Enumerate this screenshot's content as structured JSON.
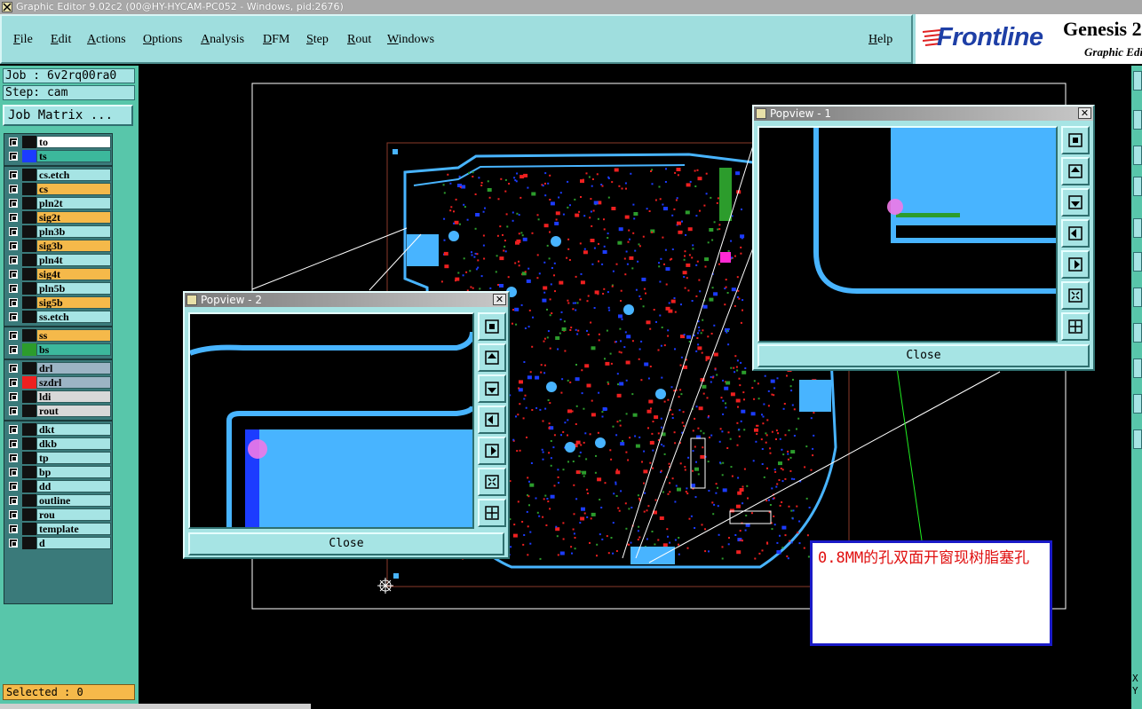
{
  "window": {
    "title": "Graphic Editor 9.02c2 (00@HY-HYCAM-PC052 - Windows, pid:2676)"
  },
  "menu": {
    "items": [
      "File",
      "Edit",
      "Actions",
      "Options",
      "Analysis",
      "DFM",
      "Step",
      "Rout",
      "Windows"
    ],
    "help": "Help"
  },
  "logo": {
    "brand": "Frontline",
    "product": "Genesis 2",
    "subtitle": "Graphic Edi"
  },
  "job": {
    "job_label": "Job : 6v2rq00ra0",
    "step_label": "Step: cam",
    "matrix_button": "Job Matrix ..."
  },
  "layers": [
    {
      "name": "to",
      "color": "#ffffff",
      "swatch": "#111111"
    },
    {
      "name": "ts",
      "color": "#3cb89c",
      "swatch": "#1c3cff"
    },
    {
      "name": "cs.etch",
      "color": "#a6e4e4",
      "swatch": "#111111"
    },
    {
      "name": "cs",
      "color": "#f5b94a",
      "swatch": "#111111"
    },
    {
      "name": "pln2t",
      "color": "#a6e4e4",
      "swatch": "#111111"
    },
    {
      "name": "sig2t",
      "color": "#f5b94a",
      "swatch": "#111111"
    },
    {
      "name": "pln3b",
      "color": "#a6e4e4",
      "swatch": "#111111"
    },
    {
      "name": "sig3b",
      "color": "#f5b94a",
      "swatch": "#111111"
    },
    {
      "name": "pln4t",
      "color": "#a6e4e4",
      "swatch": "#111111"
    },
    {
      "name": "sig4t",
      "color": "#f5b94a",
      "swatch": "#111111"
    },
    {
      "name": "pln5b",
      "color": "#a6e4e4",
      "swatch": "#111111"
    },
    {
      "name": "sig5b",
      "color": "#f5b94a",
      "swatch": "#111111"
    },
    {
      "name": "ss.etch",
      "color": "#a6e4e4",
      "swatch": "#111111"
    },
    {
      "name": "ss",
      "color": "#f5b94a",
      "swatch": "#111111"
    },
    {
      "name": "bs",
      "color": "#3cb89c",
      "swatch": "#2c9c2c"
    },
    {
      "name": "drl",
      "color": "#9cb4c4",
      "swatch": "#111111"
    },
    {
      "name": "szdrl",
      "color": "#9cb4c4",
      "swatch": "#ee2020"
    },
    {
      "name": "ldi",
      "color": "#d8d8d8",
      "swatch": "#111111"
    },
    {
      "name": "rout",
      "color": "#d8d8d8",
      "swatch": "#111111"
    },
    {
      "name": "dkt",
      "color": "#a6e4e4",
      "swatch": "#111111"
    },
    {
      "name": "dkb",
      "color": "#a6e4e4",
      "swatch": "#111111"
    },
    {
      "name": "tp",
      "color": "#a6e4e4",
      "swatch": "#111111"
    },
    {
      "name": "bp",
      "color": "#a6e4e4",
      "swatch": "#111111"
    },
    {
      "name": "dd",
      "color": "#a6e4e4",
      "swatch": "#111111"
    },
    {
      "name": "outline",
      "color": "#a6e4e4",
      "swatch": "#111111"
    },
    {
      "name": "rou",
      "color": "#a6e4e4",
      "swatch": "#111111"
    },
    {
      "name": "template",
      "color": "#a6e4e4",
      "swatch": "#111111"
    },
    {
      "name": "d",
      "color": "#a6e4e4",
      "swatch": "#111111"
    }
  ],
  "status": {
    "selected": "Selected : 0"
  },
  "popview1": {
    "title": "Popview - 1",
    "close_label": "Close"
  },
  "popview2": {
    "title": "Popview - 2",
    "close_label": "Close"
  },
  "annotation": {
    "text": "0.8MM的孔双面开窗现树脂塞孔"
  },
  "right_edge": {
    "coord_x": "X",
    "coord_y": "Y"
  },
  "colors": {
    "panel": "#58c6aa",
    "button": "#a6e4e4",
    "pad_blue": "#48b4ff",
    "trace_red": "#ee2020",
    "via_blue": "#1c3cff"
  }
}
